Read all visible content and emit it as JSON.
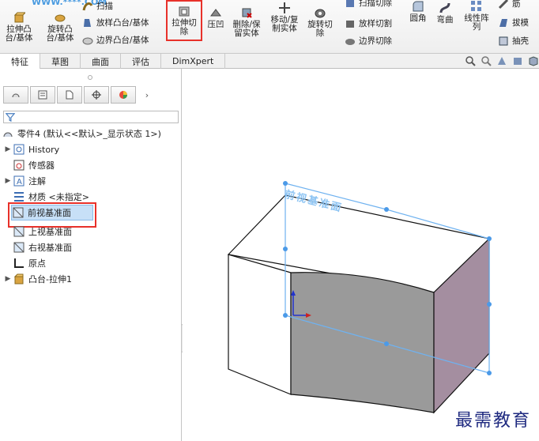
{
  "ribbon": {
    "extrude_boss_label": "拉伸凸\n台/基体",
    "revolve_boss_label": "旋转凸\n台/基体",
    "sweep_label": "扫描",
    "loft_boss_label": "放样凸台/基体",
    "boundary_boss_label": "边界凸台/基体",
    "extruded_cut_label": "拉伸切\n除",
    "indent_label": "压凹",
    "delete_keep_body_label": "删除/保\n留实体",
    "move_copy_body_label": "移动/复\n制实体",
    "revolved_cut_label": "旋转切\n除",
    "swept_cut_label": "扫描切除",
    "lofted_cut_label": "放样切割",
    "boundary_cut_label": "边界切除",
    "fillet_label": "圆角",
    "flex_label": "弯曲",
    "linear_pattern_label": "线性阵\n列",
    "rib_label": "筋",
    "draft_label": "拔模",
    "shell_label": "抽壳",
    "logo_text": "WWW.****.COM"
  },
  "tabs": [
    {
      "label": "特征",
      "active": true
    },
    {
      "label": "草图",
      "active": false
    },
    {
      "label": "曲面",
      "active": false
    },
    {
      "label": "评估",
      "active": false
    },
    {
      "label": "DimXpert",
      "active": false
    }
  ],
  "tree": {
    "root": "零件4 (默认<<默认>_显示状态 1>)",
    "items": [
      {
        "label": "History",
        "expandable": true
      },
      {
        "label": "传感器",
        "expandable": false
      },
      {
        "label": "注解",
        "expandable": true
      },
      {
        "label": "材质 <未指定>",
        "expandable": false
      },
      {
        "label": "前视基准面",
        "expandable": false,
        "selected": true
      },
      {
        "label": "上视基准面",
        "expandable": false
      },
      {
        "label": "右视基准面",
        "expandable": false
      },
      {
        "label": "原点",
        "expandable": false
      },
      {
        "label": "凸台-拉伸1",
        "expandable": true
      }
    ]
  },
  "viewport": {
    "plane_label": "前视基准面"
  },
  "watermark": "最需教育",
  "colors": {
    "highlight": "#e8312a",
    "plane": "#6fb2f0",
    "face_gray": "#9a9a9a",
    "face_side": "#a48ea0"
  }
}
